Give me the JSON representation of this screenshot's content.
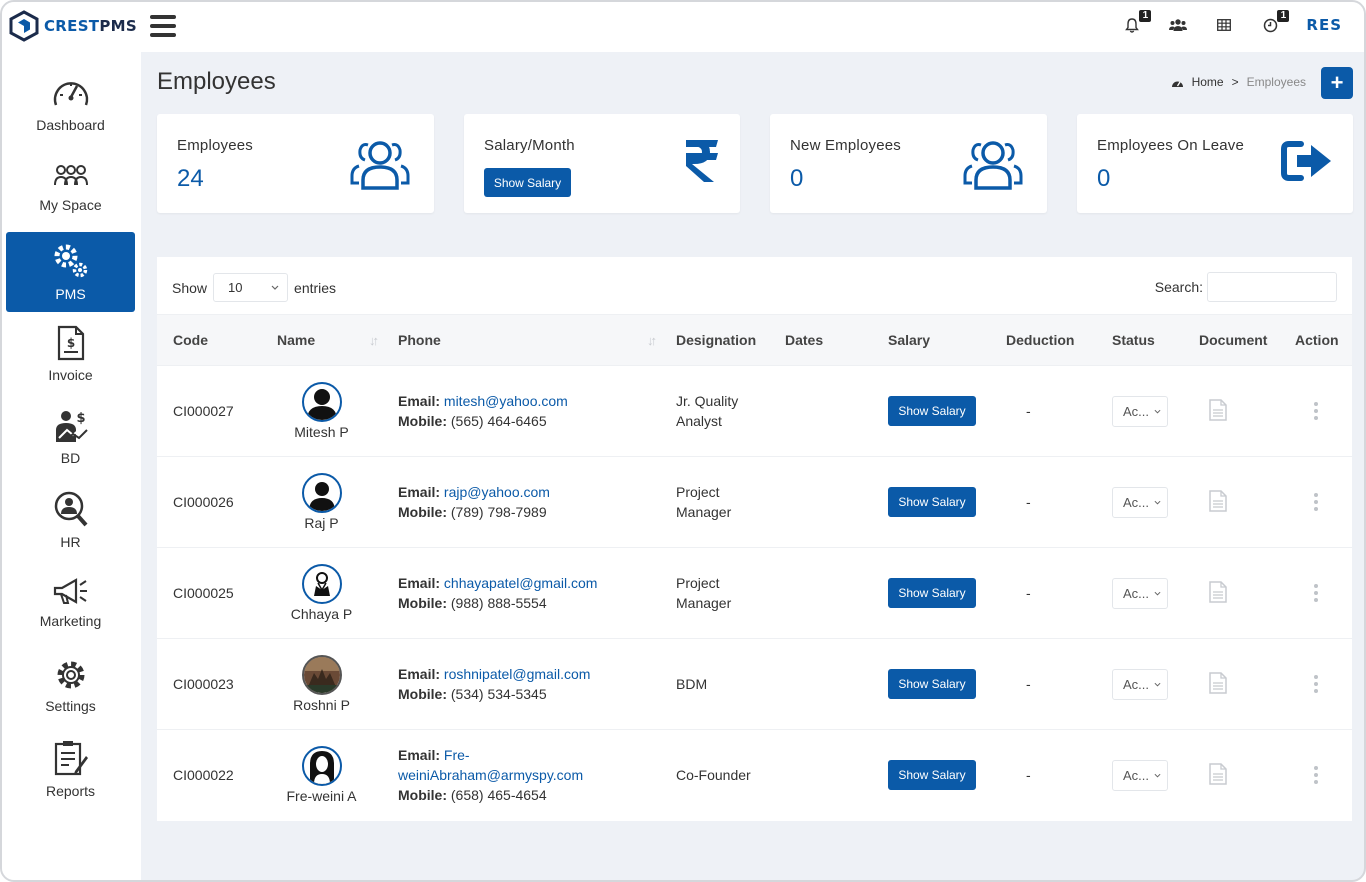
{
  "app": {
    "logo_text_1": "CREST",
    "logo_text_2": "PMS",
    "user_initials": "RES"
  },
  "topbar": {
    "notifications_count": "1",
    "timer_count": "1"
  },
  "sidebar": {
    "items": [
      {
        "label": "Dashboard",
        "icon": "dashboard-gauge-icon"
      },
      {
        "label": "My Space",
        "icon": "team-icon"
      },
      {
        "label": "PMS",
        "icon": "gears-icon",
        "active": true
      },
      {
        "label": "Invoice",
        "icon": "invoice-icon"
      },
      {
        "label": "BD",
        "icon": "business-growth-icon"
      },
      {
        "label": "HR",
        "icon": "hr-search-icon"
      },
      {
        "label": "Marketing",
        "icon": "megaphone-icon"
      },
      {
        "label": "Settings",
        "icon": "gear-icon"
      },
      {
        "label": "Reports",
        "icon": "reports-icon"
      }
    ]
  },
  "page": {
    "title": "Employees",
    "breadcrumb_home": "Home",
    "breadcrumb_sep": ">",
    "breadcrumb_current": "Employees",
    "add_label": "+"
  },
  "cards": [
    {
      "title": "Employees",
      "value": "24",
      "icon": "users-icon"
    },
    {
      "title": "Salary/Month",
      "button": "Show Salary",
      "icon": "rupee-icon"
    },
    {
      "title": "New Employees",
      "value": "0",
      "icon": "users-icon"
    },
    {
      "title": "Employees On Leave",
      "value": "0",
      "icon": "sign-out-icon"
    }
  ],
  "table": {
    "show_label": "Show",
    "entries_value": "10",
    "entries_label": "entries",
    "search_label": "Search:",
    "columns": [
      "Code",
      "Name",
      "Phone",
      "Designation",
      "Dates",
      "Salary",
      "Deduction",
      "Status",
      "Document",
      "Action"
    ],
    "email_label": "Email:",
    "mobile_label": "Mobile:",
    "rows": [
      {
        "code": "CI000027",
        "name": "Mitesh P",
        "email": "mitesh@yahoo.com",
        "mobile": "(565) 464-6465",
        "designation_1": "Jr. Quality",
        "designation_2": "Analyst",
        "dates": "",
        "salary": "Show Salary",
        "deduction": "-",
        "status": "Ac..."
      },
      {
        "code": "CI000026",
        "name": "Raj P",
        "email": "rajp@yahoo.com",
        "mobile": "(789) 798-7989",
        "designation_1": "Project",
        "designation_2": "Manager",
        "dates": "",
        "salary": "Show Salary",
        "deduction": "-",
        "status": "Ac..."
      },
      {
        "code": "CI000025",
        "name": "Chhaya P",
        "email": "chhayapatel@gmail.com",
        "mobile": "(988) 888-5554",
        "designation_1": "Project",
        "designation_2": "Manager",
        "dates": "",
        "salary": "Show Salary",
        "deduction": "-",
        "status": "Ac..."
      },
      {
        "code": "CI000023",
        "name": "Roshni P",
        "email": "roshnipatel@gmail.com",
        "mobile": "(534) 534-5345",
        "designation_1": "BDM",
        "designation_2": "",
        "dates": "",
        "salary": "Show Salary",
        "deduction": "-",
        "status": "Ac..."
      },
      {
        "code": "CI000022",
        "name": "Fre-weini A",
        "email_1": "Fre-",
        "email_2": "weiniAbraham@armyspy.com",
        "mobile": "(658) 465-4654",
        "designation_1": "Co-Founder",
        "designation_2": "",
        "dates": "",
        "salary": "Show Salary",
        "deduction": "-",
        "status": "Ac..."
      }
    ]
  },
  "colors": {
    "primary": "#0b5aa8",
    "background": "#eef1f6"
  }
}
